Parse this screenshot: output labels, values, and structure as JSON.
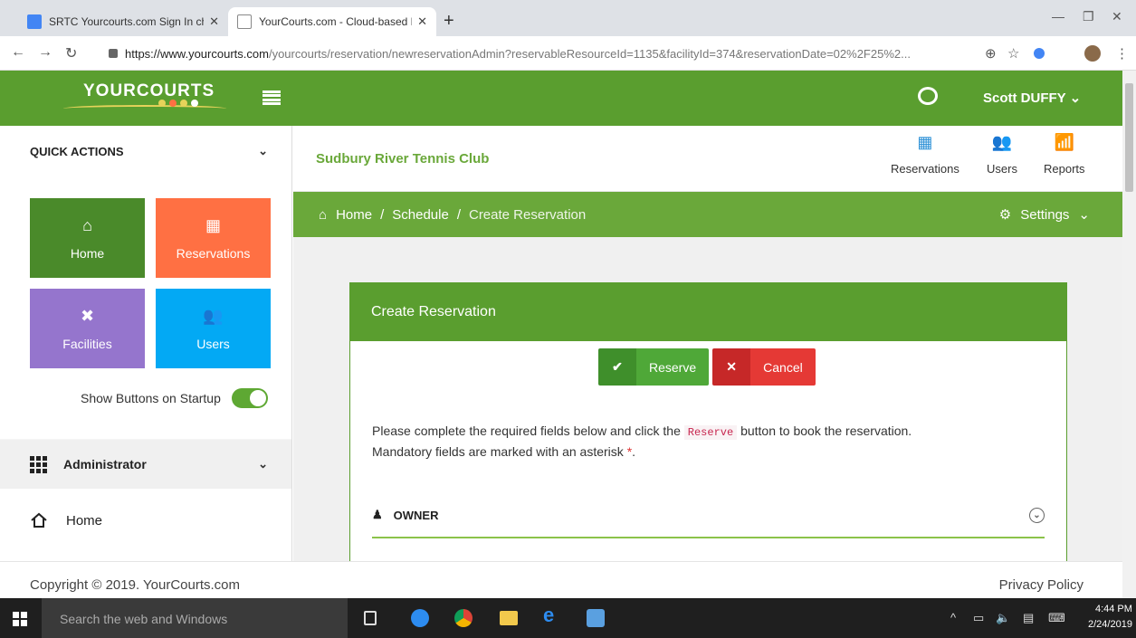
{
  "browser": {
    "tabs": [
      {
        "title": "SRTC Yourcourts.com Sign In che",
        "close": "✕"
      },
      {
        "title": "YourCourts.com - Cloud-based R",
        "close": "✕"
      }
    ],
    "new_tab": "+",
    "url_host": "https://www.yourcourts.com",
    "url_path": "/yourcourts/reservation/newreservationAdmin?reservableResourceId=1135&facilityId=374&reservationDate=02%2F25%2..."
  },
  "header": {
    "logo": "YOURCOURTS",
    "user": "Scott DUFFY"
  },
  "sidebar": {
    "quick_actions": "QUICK ACTIONS",
    "buttons": [
      {
        "label": "Home",
        "icon": "⌂",
        "color": "#4a8a2a"
      },
      {
        "label": "Reservations",
        "icon": "▦",
        "color": "#ff7043"
      },
      {
        "label": "Facilities",
        "icon": "✖",
        "color": "#9575cd"
      },
      {
        "label": "Users",
        "icon": "👥",
        "color": "#03a9f4"
      }
    ],
    "show_on_startup": "Show Buttons on Startup",
    "admin_section": "Administrator",
    "menu_home": "Home"
  },
  "club": {
    "name": "Sudbury River Tennis Club",
    "nav": [
      {
        "label": "Reservations",
        "icon": "▦"
      },
      {
        "label": "Users",
        "icon": "👥"
      },
      {
        "label": "Reports",
        "icon": "📶"
      }
    ]
  },
  "breadcrumb": {
    "home": "Home",
    "sep": "/",
    "schedule": "Schedule",
    "current": "Create Reservation",
    "settings": "Settings"
  },
  "form": {
    "title": "Create Reservation",
    "reserve_label": "Reserve",
    "cancel_label": "Cancel",
    "instr_before": "Please complete the required fields below and click the",
    "instr_code": "Reserve",
    "instr_after": "button to book the reservation.",
    "instr_line2": "Mandatory fields are marked with an asterisk",
    "asterisk": "*",
    "period": ".",
    "owner_section": "OWNER"
  },
  "footer": {
    "copyright": "Copyright © 2019. YourCourts.com",
    "privacy": "Privacy Policy"
  },
  "taskbar": {
    "search_placeholder": "Search the web and Windows",
    "time": "4:44 PM",
    "date": "2/24/2019"
  },
  "colors": {
    "brand_green": "#5a9e2f",
    "breadcrumb_green": "#6aa83a"
  }
}
